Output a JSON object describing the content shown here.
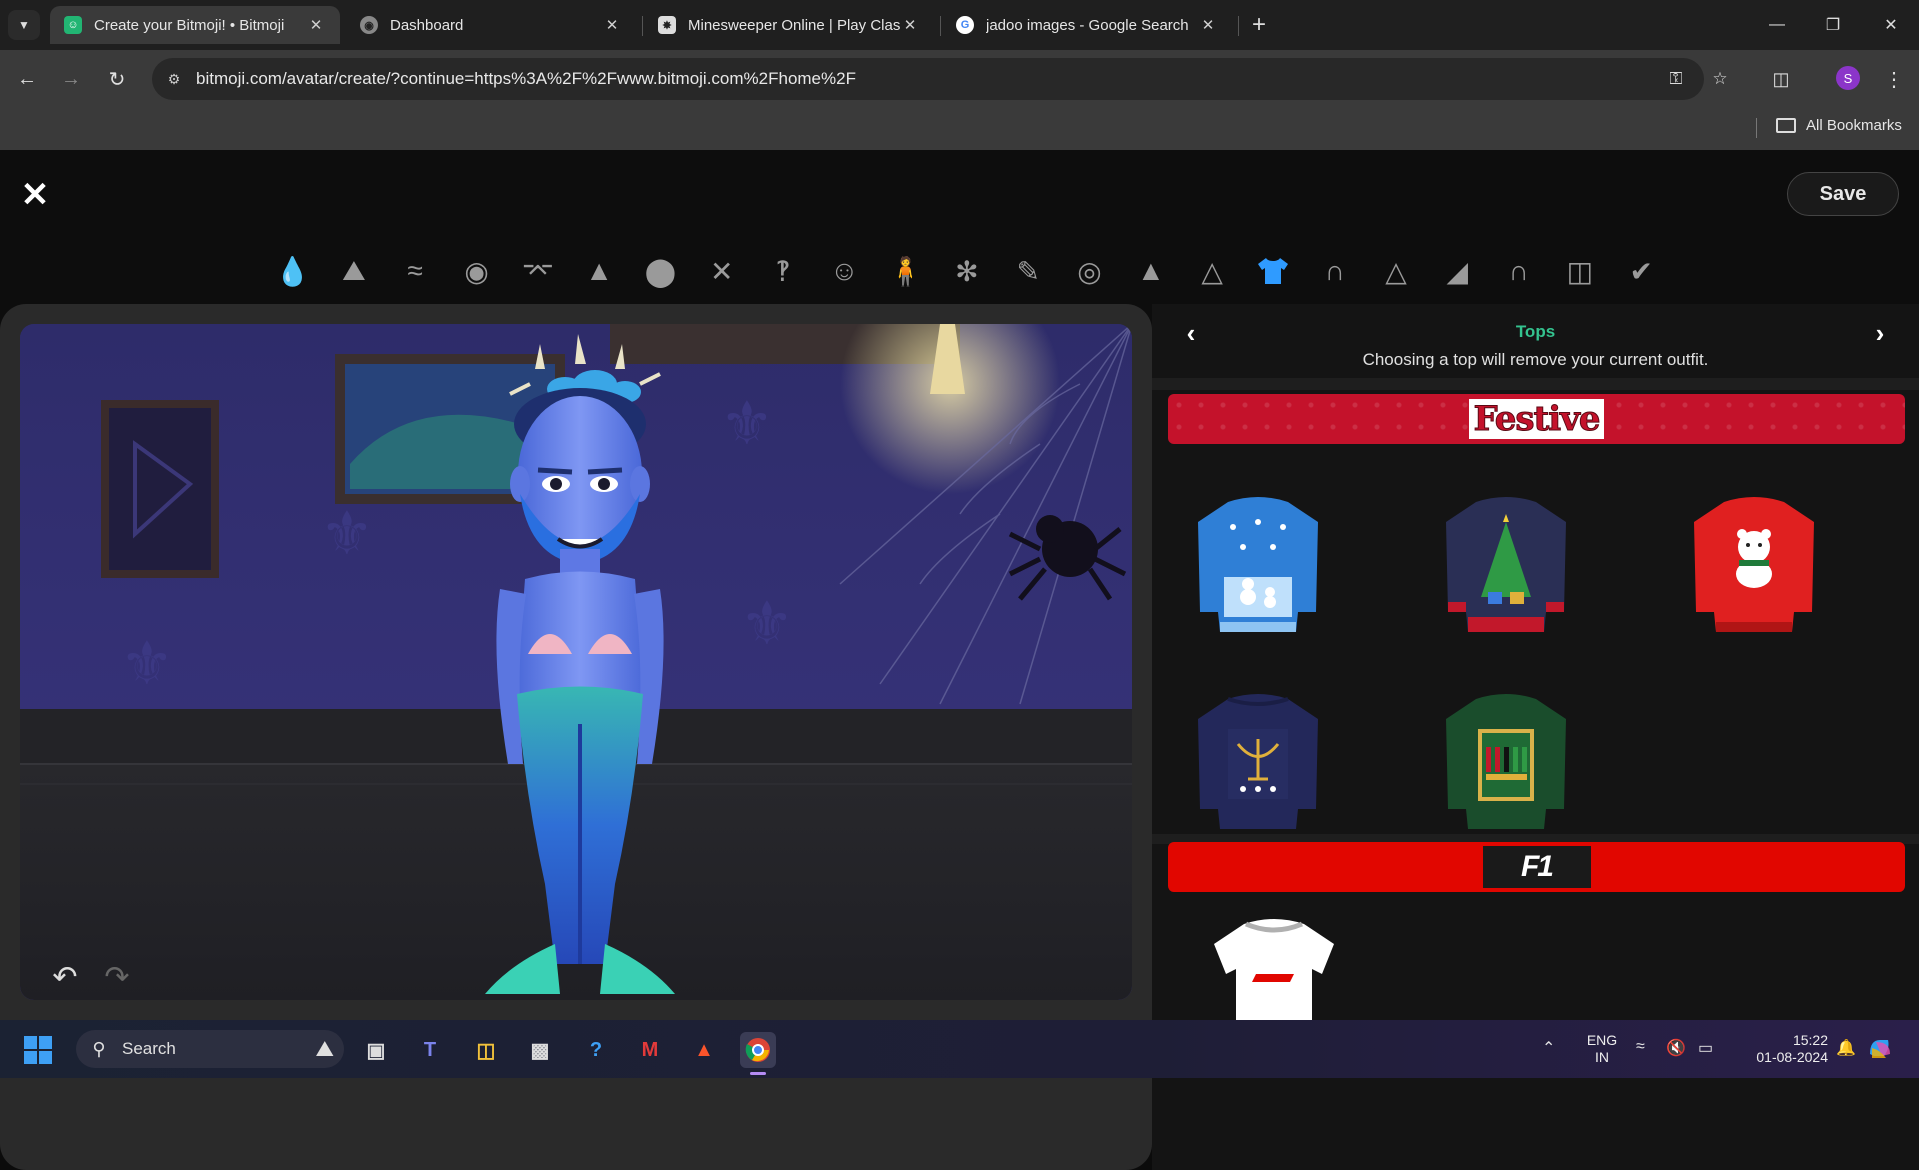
{
  "browser": {
    "tabs": [
      {
        "title": "Create your Bitmoji! • Bitmoji",
        "active": true
      },
      {
        "title": "Dashboard",
        "active": false
      },
      {
        "title": "Minesweeper Online | Play Clas",
        "active": false
      },
      {
        "title": "jadoo images - Google Search",
        "active": false
      }
    ],
    "url": "bitmoji.com/avatar/create/?continue=https%3A%2F%2Fwww.bitmoji.com%2Fhome%2F",
    "profile_initial": "S",
    "bookmarks_label": "All Bookmarks"
  },
  "page": {
    "save_label": "Save",
    "categories": [
      {
        "name": "skin-tone",
        "icon": "skin-drop-icon"
      },
      {
        "name": "hair",
        "icon": "hair-icon"
      },
      {
        "name": "facial-hair",
        "icon": "mustache-icon"
      },
      {
        "name": "eyes",
        "icon": "eye-icon"
      },
      {
        "name": "eyebrows",
        "icon": "eyebrow-icon"
      },
      {
        "name": "nose",
        "icon": "nose-icon"
      },
      {
        "name": "face-shape",
        "icon": "face-shape-icon"
      },
      {
        "name": "mouth",
        "icon": "lips-icon"
      },
      {
        "name": "ears",
        "icon": "ear-icon"
      },
      {
        "name": "face-lines",
        "icon": "face-lines-icon"
      },
      {
        "name": "body",
        "icon": "body-icon"
      },
      {
        "name": "outfit-presets",
        "icon": "outfit-icon"
      },
      {
        "name": "makeup",
        "icon": "pencil-icon"
      },
      {
        "name": "glasses",
        "icon": "glasses-icon"
      },
      {
        "name": "hat",
        "icon": "hat-icon"
      },
      {
        "name": "hanger",
        "icon": "hanger-icon"
      },
      {
        "name": "tops",
        "icon": "tshirt-icon",
        "active": true
      },
      {
        "name": "bottoms",
        "icon": "pants-icon"
      },
      {
        "name": "dress",
        "icon": "dress-icon"
      },
      {
        "name": "shoes",
        "icon": "shoe-icon"
      },
      {
        "name": "outerwear",
        "icon": "jacket-icon"
      },
      {
        "name": "closet",
        "icon": "closet-icon"
      },
      {
        "name": "done",
        "icon": "checkmark-icon"
      }
    ],
    "panel": {
      "title": "Tops",
      "subtitle": "Choosing a top will remove your current outfit.",
      "sections": [
        {
          "banner": "Festive",
          "items": [
            {
              "name": "snowman-blue-sweater",
              "color": "#2f7fd6"
            },
            {
              "name": "christmas-tree-navy-sweater",
              "color": "#2a2f55"
            },
            {
              "name": "polar-bear-red-sweater",
              "color": "#e02020"
            },
            {
              "name": "menorah-navy-sweater",
              "color": "#23285a"
            },
            {
              "name": "kinara-green-sweater",
              "color": "#1a4d2c"
            }
          ]
        },
        {
          "banner": "F1",
          "items": [
            {
              "name": "f1-white-tshirt",
              "color": "#ffffff"
            }
          ]
        }
      ]
    }
  },
  "taskbar": {
    "search_label": "Search",
    "lang_line1": "ENG",
    "lang_line2": "IN",
    "time": "15:22",
    "date": "01-08-2024"
  },
  "colors": {
    "accent_green": "#34c38f",
    "active_blue": "#2f9bff",
    "festive_red": "#c4122b",
    "f1_red": "#e10600"
  }
}
